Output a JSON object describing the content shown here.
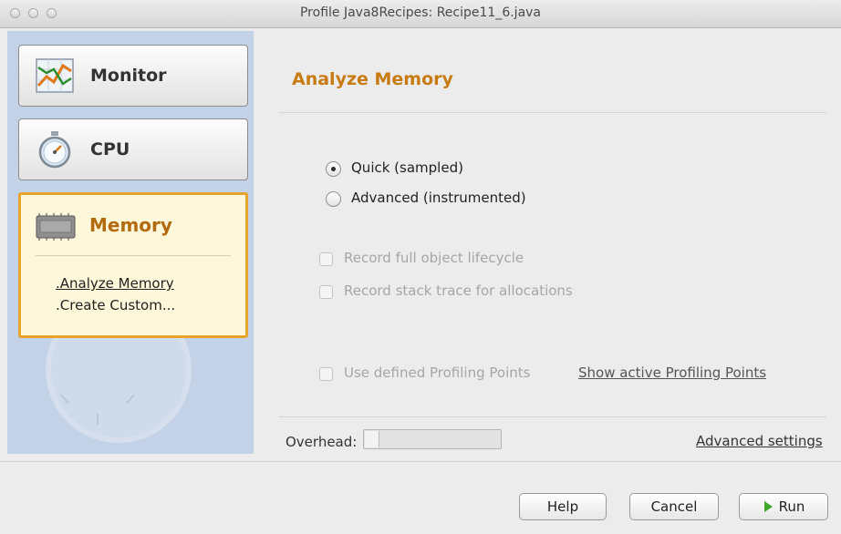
{
  "window": {
    "title": "Profile Java8Recipes: Recipe11_6.java"
  },
  "sidebar": {
    "monitor_label": "Monitor",
    "cpu_label": "CPU",
    "memory_label": "Memory",
    "memory_items": [
      {
        "label": ".Analyze Memory"
      },
      {
        "label": ".Create Custom..."
      }
    ]
  },
  "main": {
    "title": "Analyze Memory",
    "radio_quick": "Quick (sampled)",
    "radio_advanced": "Advanced (instrumented)",
    "check_lifecycle": "Record full object lifecycle",
    "check_stack": "Record stack trace for allocations",
    "check_points": "Use defined Profiling Points",
    "show_points_link": "Show active Profiling Points",
    "overhead_label": "Overhead:",
    "overhead_level": 0.1,
    "advanced_settings": "Advanced settings"
  },
  "footer": {
    "help": "Help",
    "cancel": "Cancel",
    "run": "Run"
  }
}
